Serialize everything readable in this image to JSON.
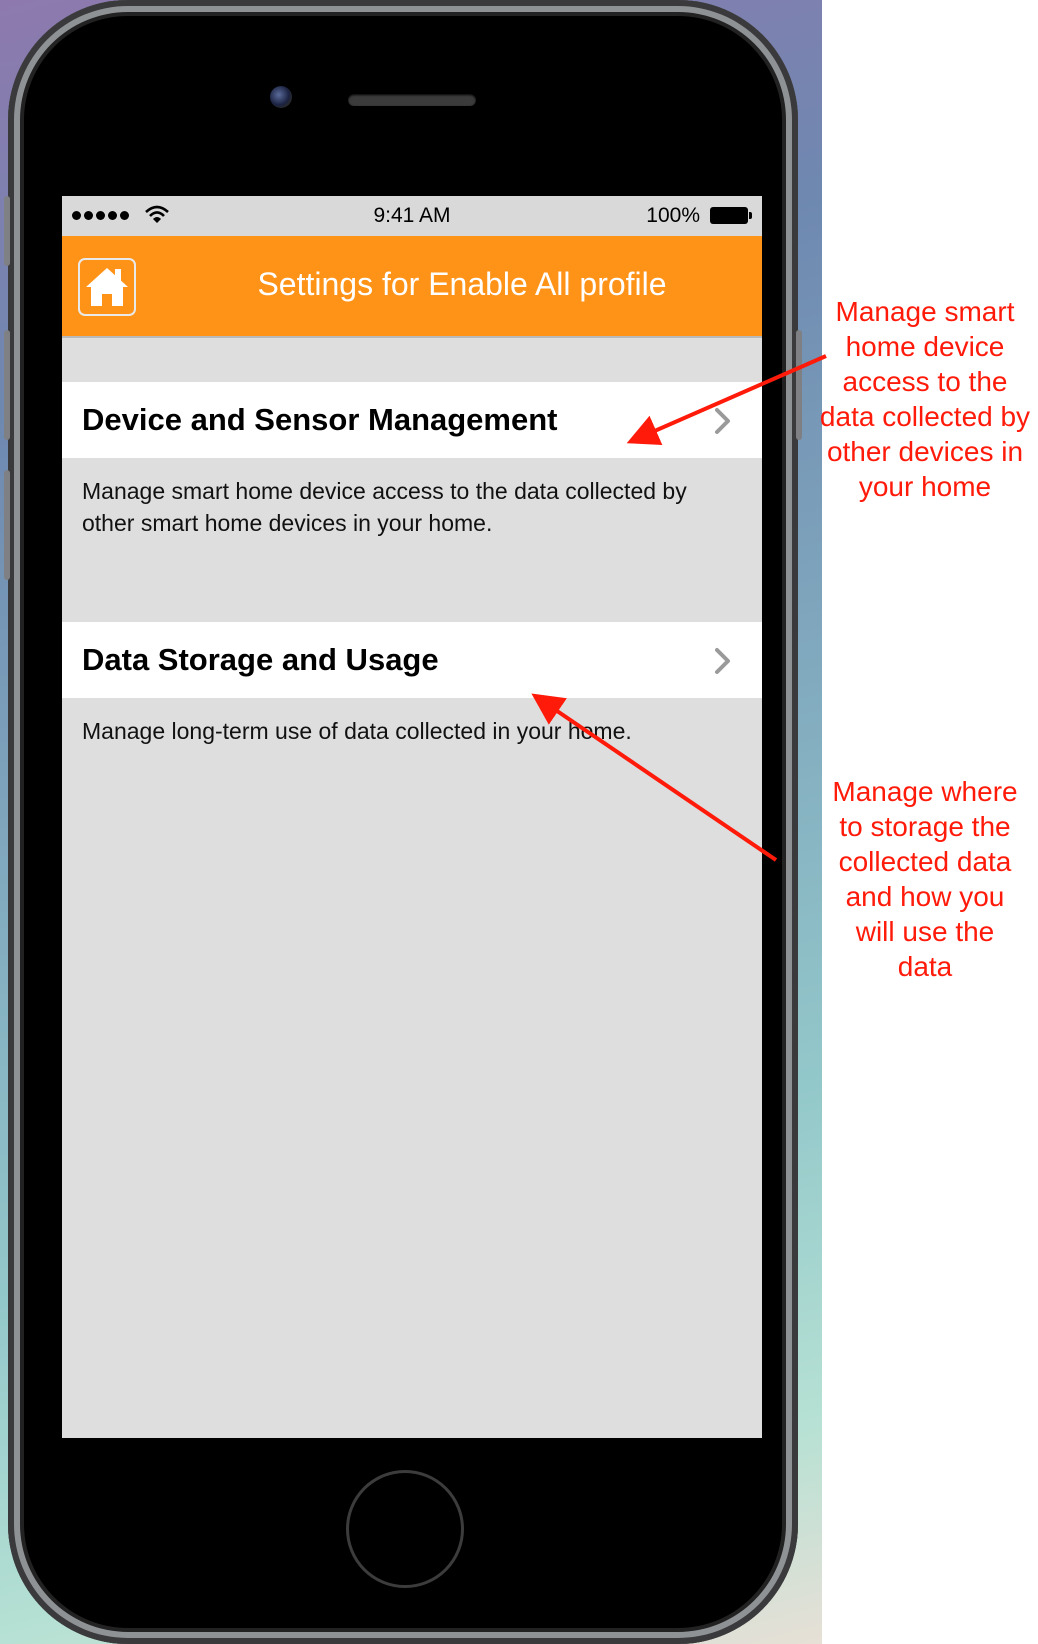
{
  "status_bar": {
    "time": "9:41 AM",
    "battery": "100%",
    "signal_icon": "signal-dots-icon",
    "wifi_icon": "wifi-icon"
  },
  "nav": {
    "title": "Settings for Enable All profile",
    "home_icon": "home-icon"
  },
  "settings": {
    "items": [
      {
        "label": "Device and Sensor Management",
        "description": "Manage smart home device access to the data collected by other smart home devices in your home."
      },
      {
        "label": "Data Storage and Usage",
        "description": "Manage long-term use of data collected in your home."
      }
    ]
  },
  "annotations": {
    "first_lines": [
      "Manage smart",
      "home device",
      "access to the",
      "data collected by",
      "other devices in",
      "your home"
    ],
    "second_lines": [
      "Manage where",
      "to storage the",
      "collected data",
      "and how you",
      "will use the",
      "data"
    ]
  },
  "colors": {
    "navbar": "#ff9318",
    "annotation": "#ff1a0a",
    "screen_background": "#dedede"
  }
}
